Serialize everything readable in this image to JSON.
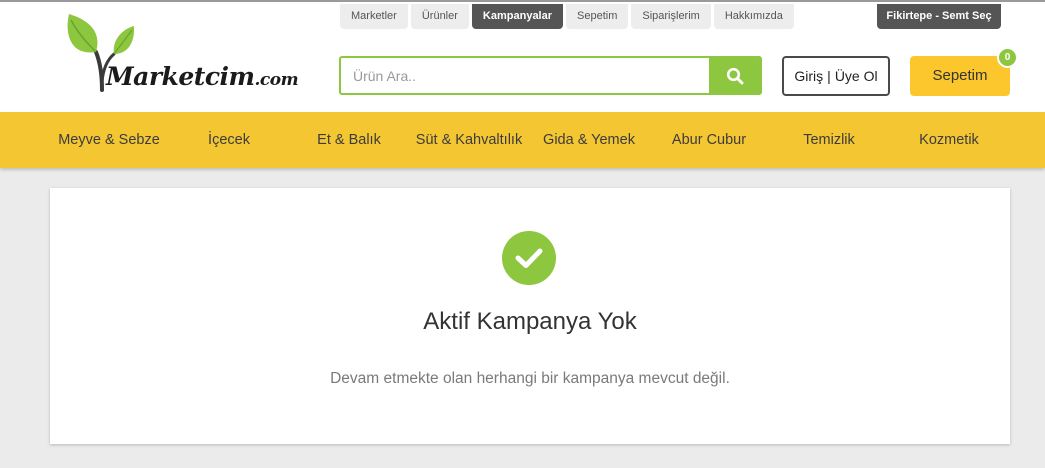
{
  "brand": {
    "name": "Marketcim",
    "suffix": ".com"
  },
  "top_tabs": [
    {
      "label": "Marketler",
      "active": false
    },
    {
      "label": "Ürünler",
      "active": false
    },
    {
      "label": "Kampanyalar",
      "active": true
    },
    {
      "label": "Sepetim",
      "active": false
    },
    {
      "label": "Siparişlerim",
      "active": false
    },
    {
      "label": "Hakkımızda",
      "active": false
    }
  ],
  "district_label": "Fikirtepe - Semt Seç",
  "search": {
    "placeholder": "Ürün Ara..",
    "value": "",
    "button_icon": "search-icon"
  },
  "auth": {
    "login_label": "Giriş",
    "separator": "|",
    "register_label": "Üye Ol"
  },
  "cart": {
    "label": "Sepetim",
    "count": "0"
  },
  "categories": [
    "Meyve & Sebze",
    "İçecek",
    "Et & Balık",
    "Süt & Kahvaltılık",
    "Gida & Yemek",
    "Abur Cubur",
    "Temizlik",
    "Kozmetik"
  ],
  "notice": {
    "icon": "checkmark-icon",
    "title": "Aktif Kampanya Yok",
    "message": "Devam etmekte olan herhangi bir kampanya mevcut değil."
  },
  "colors": {
    "accent_green": "#8dc63f",
    "category_bar": "#f4c631",
    "cart_button": "#fcc62d",
    "dark_tab": "#555555"
  }
}
